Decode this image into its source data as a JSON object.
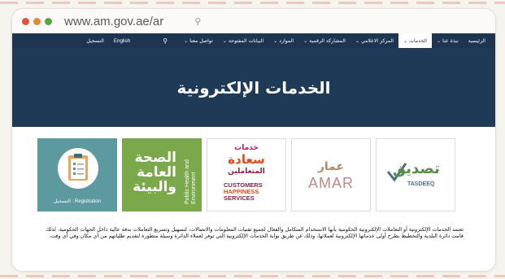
{
  "browser": {
    "url": "www.am.gov.ae/ar",
    "dot_colors": [
      "#e0533c",
      "#e38a3a",
      "#59a446"
    ]
  },
  "navbar": {
    "items": [
      {
        "label": "الرئيسية",
        "active": false
      },
      {
        "label": "نبذة عنا ⌄",
        "active": false
      },
      {
        "label": "الخدمات ⌄",
        "active": true
      },
      {
        "label": "المركز الاعلامي ⌄",
        "active": false
      },
      {
        "label": "المشاركة الرقمية ⌄",
        "active": false
      },
      {
        "label": "الموارد ⌄",
        "active": false
      },
      {
        "label": "البيانات المفتوحة ⌄",
        "active": false
      },
      {
        "label": "تواصل معنا ⌄",
        "active": false
      }
    ],
    "language": "English",
    "login": "التسجيل"
  },
  "hero": {
    "title": "الخدمات الإلكترونية",
    "background": "#1f3a56"
  },
  "cards": {
    "registration": {
      "caption": "التسجيل : Registration"
    },
    "health": {
      "ar": "الصحة العامة والبيئة",
      "en": "Public Health and Environment"
    },
    "customers": {
      "ar_line1": "خدمات",
      "ar_line2": "سعادة",
      "ar_line3": "المتعاملين",
      "en_line1": "CUSTOMERS",
      "en_line2": "HAPPINESS",
      "en_line3": "SERVICES"
    },
    "amar": {
      "ar": "عمار",
      "en": "AMAR"
    },
    "tasdeeq": {
      "ar": "تصديق",
      "en": "TASDEEQ"
    }
  },
  "description": "تعتمد الخدمات الإلكترونية أو التعاملات الإلكترونية الحكومية بأنها الاستخدام المتكامل والفعال لجميع تقنيات المعلومات والاتصالات، لتسهيل وتسريع التعاملات بدقة عالية داخل الجهات الحكومية. لذلك قامت دائرة البلدية والتخطيط بطرح أولى خدماتها الإلكترونية لعملائها، وذلك عن طريق بوابة الخدمات الإلكترونية التي توفر لعملاء الدائرة وسيلة متطورة لتقديم طلباتهم من أي مكان وفي أي وقت."
}
